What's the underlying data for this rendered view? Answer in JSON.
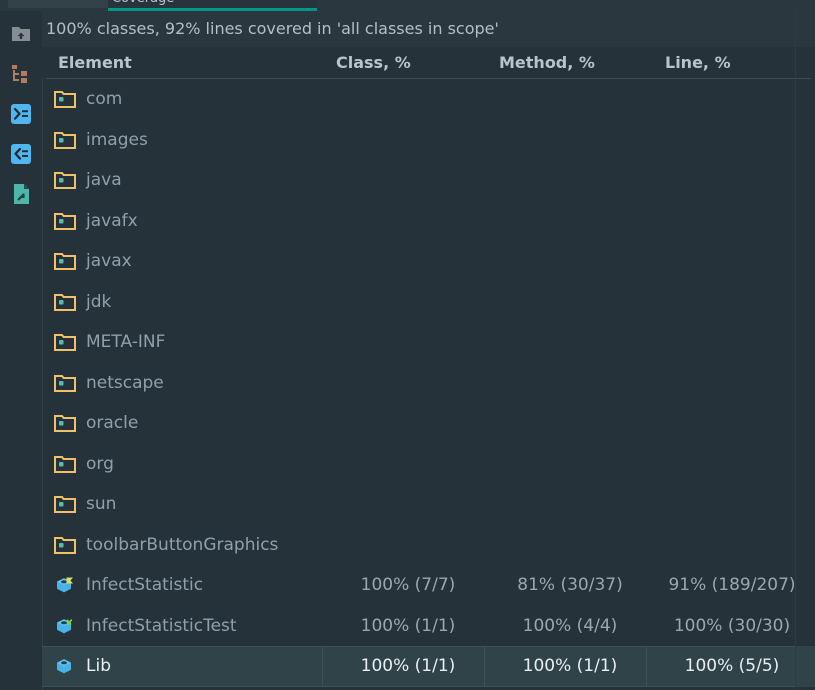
{
  "window": {
    "tab_label": "Coverage",
    "accent_color": "#029688",
    "background": "#26323a"
  },
  "toolbar": {
    "buttons": [
      {
        "name": "go-up-folder-icon",
        "tooltip": "Go Up"
      },
      {
        "name": "flatten-packages-icon",
        "tooltip": "Flatten Packages"
      },
      {
        "name": "expand-all-icon",
        "tooltip": "Expand All"
      },
      {
        "name": "collapse-all-icon",
        "tooltip": "Collapse All"
      },
      {
        "name": "generate-report-icon",
        "tooltip": "Generate Coverage Report"
      }
    ]
  },
  "summary": {
    "text": "100% classes, 92% lines covered in 'all classes in scope'"
  },
  "table": {
    "columns": [
      {
        "label": "Element"
      },
      {
        "label": "Class, %"
      },
      {
        "label": "Method, %"
      },
      {
        "label": "Line, %"
      }
    ],
    "rows": [
      {
        "icon": "folder-icon",
        "kind": "folder",
        "name": "com",
        "class_pct": "",
        "method_pct": "",
        "line_pct": "",
        "selected": false
      },
      {
        "icon": "folder-icon",
        "kind": "folder",
        "name": "images",
        "class_pct": "",
        "method_pct": "",
        "line_pct": "",
        "selected": false
      },
      {
        "icon": "folder-icon",
        "kind": "folder",
        "name": "java",
        "class_pct": "",
        "method_pct": "",
        "line_pct": "",
        "selected": false
      },
      {
        "icon": "folder-icon",
        "kind": "folder",
        "name": "javafx",
        "class_pct": "",
        "method_pct": "",
        "line_pct": "",
        "selected": false
      },
      {
        "icon": "folder-icon",
        "kind": "folder",
        "name": "javax",
        "class_pct": "",
        "method_pct": "",
        "line_pct": "",
        "selected": false
      },
      {
        "icon": "folder-icon",
        "kind": "folder",
        "name": "jdk",
        "class_pct": "",
        "method_pct": "",
        "line_pct": "",
        "selected": false
      },
      {
        "icon": "folder-icon",
        "kind": "folder",
        "name": "META-INF",
        "class_pct": "",
        "method_pct": "",
        "line_pct": "",
        "selected": false
      },
      {
        "icon": "folder-icon",
        "kind": "folder",
        "name": "netscape",
        "class_pct": "",
        "method_pct": "",
        "line_pct": "",
        "selected": false
      },
      {
        "icon": "folder-icon",
        "kind": "folder",
        "name": "oracle",
        "class_pct": "",
        "method_pct": "",
        "line_pct": "",
        "selected": false
      },
      {
        "icon": "folder-icon",
        "kind": "folder",
        "name": "org",
        "class_pct": "",
        "method_pct": "",
        "line_pct": "",
        "selected": false
      },
      {
        "icon": "folder-icon",
        "kind": "folder",
        "name": "sun",
        "class_pct": "",
        "method_pct": "",
        "line_pct": "",
        "selected": false
      },
      {
        "icon": "folder-icon",
        "kind": "folder",
        "name": "toolbarButtonGraphics",
        "class_pct": "",
        "method_pct": "",
        "line_pct": "",
        "selected": false
      },
      {
        "icon": "class-icon",
        "kind": "class",
        "name": "InfectStatistic",
        "class_pct": "100% (7/7)",
        "method_pct": "81% (30/37)",
        "line_pct": "91% (189/207)",
        "selected": false
      },
      {
        "icon": "class-test-icon",
        "kind": "class-test",
        "name": "InfectStatisticTest",
        "class_pct": "100% (1/1)",
        "method_pct": "100% (4/4)",
        "line_pct": "100% (30/30)",
        "selected": false
      },
      {
        "icon": "class-icon-plain",
        "kind": "class",
        "name": "Lib",
        "class_pct": "100% (1/1)",
        "method_pct": "100% (1/1)",
        "line_pct": "100% (5/5)",
        "selected": true
      }
    ]
  }
}
